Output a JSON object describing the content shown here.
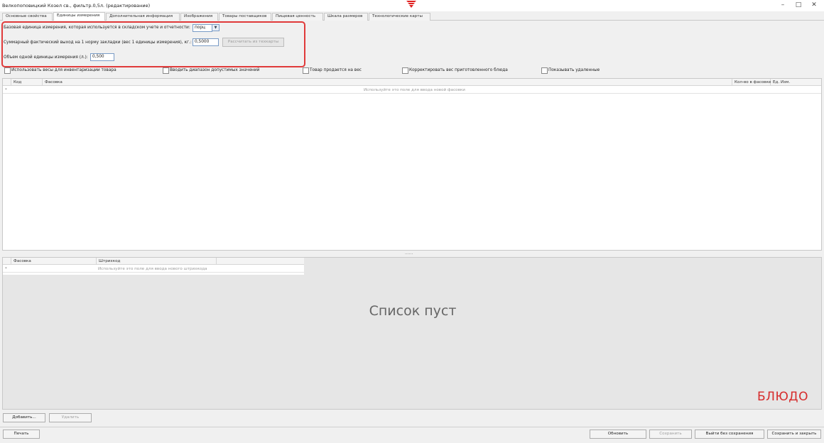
{
  "window": {
    "title": "Велкопоповицкий Козел св., фильтр.0,5л. (редактирование)",
    "controls": {
      "minimize": "–",
      "maximize": "□",
      "close": "✕"
    }
  },
  "tabs": [
    {
      "label": "Основные свойства",
      "active": false
    },
    {
      "label": "Единицы измерения",
      "active": true
    },
    {
      "label": "Дополнительная информация",
      "active": false
    },
    {
      "label": "Изображения",
      "active": false
    },
    {
      "label": "Товары поставщиков",
      "active": false
    },
    {
      "label": "Пищевая ценность",
      "active": false
    },
    {
      "label": "Шкала размеров",
      "active": false
    },
    {
      "label": "Технологические карты",
      "active": false
    }
  ],
  "settings": {
    "base_unit_label": "Базовая единица измерения, которая используется в складском учете и отчетности:",
    "base_unit_value": "порц",
    "yield_label": "Суммарный фактический выход на 1 норму закладки (вес 1 единицы измерения), кг.:",
    "yield_value": "0,5000",
    "calc_button": "Рассчитать из техкарты",
    "volume_label": "Объем одной единицы измерения (л.):",
    "volume_value": "0,500"
  },
  "checkboxes": [
    {
      "label": "Использовать весы для инвентаризации товара",
      "checked": false
    },
    {
      "label": "Вводить диапазон допустимых значений",
      "checked": false
    },
    {
      "label": "Товар продается на вес",
      "checked": false
    },
    {
      "label": "Корректировать вес приготовленного блюда",
      "checked": false
    },
    {
      "label": "Показывать удаленные",
      "checked": false
    }
  ],
  "packages_grid": {
    "columns": [
      "Код",
      "Фасовка",
      "Кол-во в фасовке",
      "Ед. Изм."
    ],
    "new_row_marker": "*",
    "new_row_hint": "Используйте это поле для ввода новой фасовки"
  },
  "splitter": "......",
  "barcode_grid": {
    "columns": [
      "Фасовка",
      "Штрихкод"
    ],
    "new_row_marker": "*",
    "new_row_hint": "Используйте это поле для ввода нового штрихкода",
    "empty_text": "Список пуст",
    "brand": "БЛЮДО"
  },
  "actions": {
    "add": "Добавить...",
    "delete": "Удалить",
    "print": "Печать",
    "refresh": "Обновить",
    "save": "Сохранить",
    "exit_no_save": "Выйти без сохранения",
    "save_close": "Сохранить и закрыть"
  },
  "colors": {
    "highlight": "#e03a3a",
    "brand": "#d62b2b",
    "logo": "#e02020"
  }
}
